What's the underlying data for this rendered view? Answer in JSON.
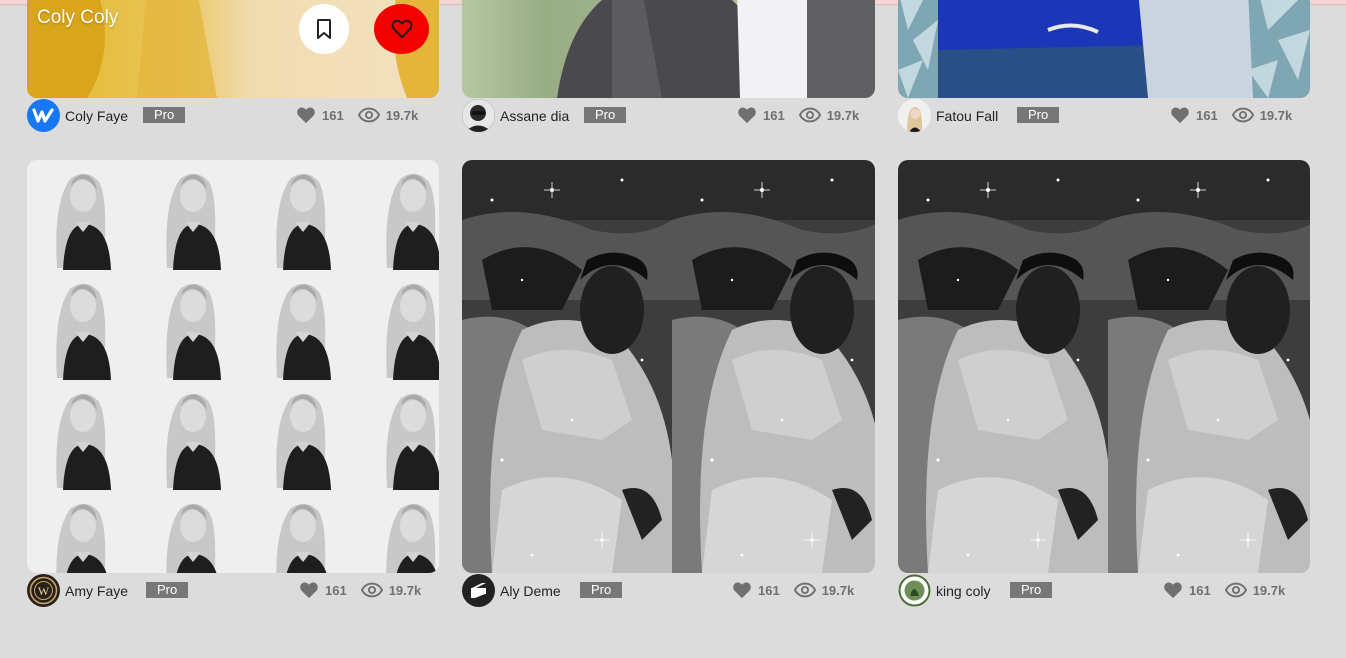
{
  "shots": [
    {
      "overlay_title": "Coly Coly",
      "author": "Coly Faye",
      "badge": "Pro",
      "likes": "161",
      "views": "19.7k",
      "avatar_icon": "blue-w-logo-icon"
    },
    {
      "author": "Assane dia",
      "badge": "Pro",
      "likes": "161",
      "views": "19.7k",
      "avatar_icon": "profile-photo-icon"
    },
    {
      "author": "Fatou Fall",
      "badge": "Pro",
      "likes": "161",
      "views": "19.7k",
      "avatar_icon": "profile-photo-icon"
    },
    {
      "author": "Amy Faye",
      "badge": "Pro",
      "likes": "161",
      "views": "19.7k",
      "avatar_icon": "crest-logo-icon"
    },
    {
      "author": "Aly Deme",
      "badge": "Pro",
      "likes": "161",
      "views": "19.7k",
      "avatar_icon": "black-s-logo-icon"
    },
    {
      "author": "king coly",
      "badge": "Pro",
      "likes": "161",
      "views": "19.7k",
      "avatar_icon": "seal-logo-icon"
    }
  ],
  "colors": {
    "like_button": "#f40000",
    "badge_bg": "#777777",
    "background": "#dcdcdc"
  }
}
